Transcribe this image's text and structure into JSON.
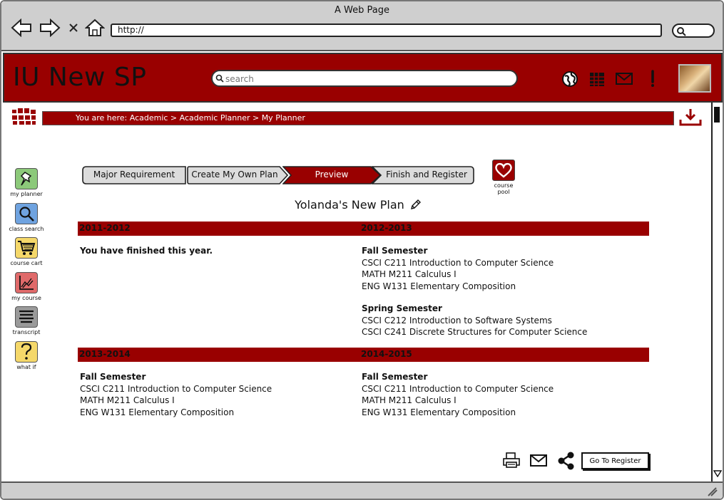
{
  "browser": {
    "title": "A Web Page",
    "address": "http://"
  },
  "header": {
    "brand": "IU New SP",
    "search_placeholder": "search"
  },
  "breadcrumb": {
    "prefix": "You are here: ",
    "path": "Academic > Academic Planner > My Planner"
  },
  "left_nav": [
    {
      "label": "my planner",
      "icon": "pin-icon",
      "color": "#8cc97a"
    },
    {
      "label": "class search",
      "icon": "search-icon",
      "color": "#6fa3e0"
    },
    {
      "label": "course cart",
      "icon": "cart-icon",
      "color": "#f5d86a"
    },
    {
      "label": "my course",
      "icon": "chart-icon",
      "color": "#e06a6a"
    },
    {
      "label": "transcript",
      "icon": "lines-icon",
      "color": "#9a9a9a"
    },
    {
      "label": "what if",
      "icon": "question-icon",
      "color": "#f5d86a"
    }
  ],
  "steps": [
    {
      "label": "Major Requirement",
      "active": false
    },
    {
      "label": "Create My Own Plan",
      "active": false
    },
    {
      "label": "Preview",
      "active": true
    },
    {
      "label": "Finish and Register",
      "active": false
    }
  ],
  "course_pool": {
    "label": "course pool"
  },
  "plan": {
    "title": "Yolanda's New Plan",
    "years": [
      {
        "year": "2011-2012",
        "note": "You have finished this year.",
        "semesters": []
      },
      {
        "year": "2012-2013",
        "note": "",
        "semesters": [
          {
            "name": "Fall Semester",
            "courses": [
              "CSCI C211 Introduction to Computer Science",
              "MATH M211 Calculus I",
              "ENG W131 Elementary Composition"
            ]
          },
          {
            "name": "Spring Semester",
            "courses": [
              "CSCI C212 Introduction to Software Systems",
              "CSCI C241 Discrete Structures for Computer Science"
            ]
          }
        ]
      },
      {
        "year": "2013-2014",
        "note": "",
        "semesters": [
          {
            "name": "Fall Semester",
            "courses": [
              "CSCI C211 Introduction to Computer Science",
              "MATH M211 Calculus I",
              "ENG W131 Elementary Composition"
            ]
          }
        ]
      },
      {
        "year": "2014-2015",
        "note": "",
        "semesters": [
          {
            "name": "Fall Semester",
            "courses": [
              "CSCI C211 Introduction to Computer Science",
              "MATH M211 Calculus I",
              "ENG W131 Elementary Composition"
            ]
          }
        ]
      }
    ]
  },
  "actions": {
    "register_label": "Go To Register"
  },
  "colors": {
    "brand_red": "#990000",
    "chrome_gray": "#cfcfcf"
  }
}
